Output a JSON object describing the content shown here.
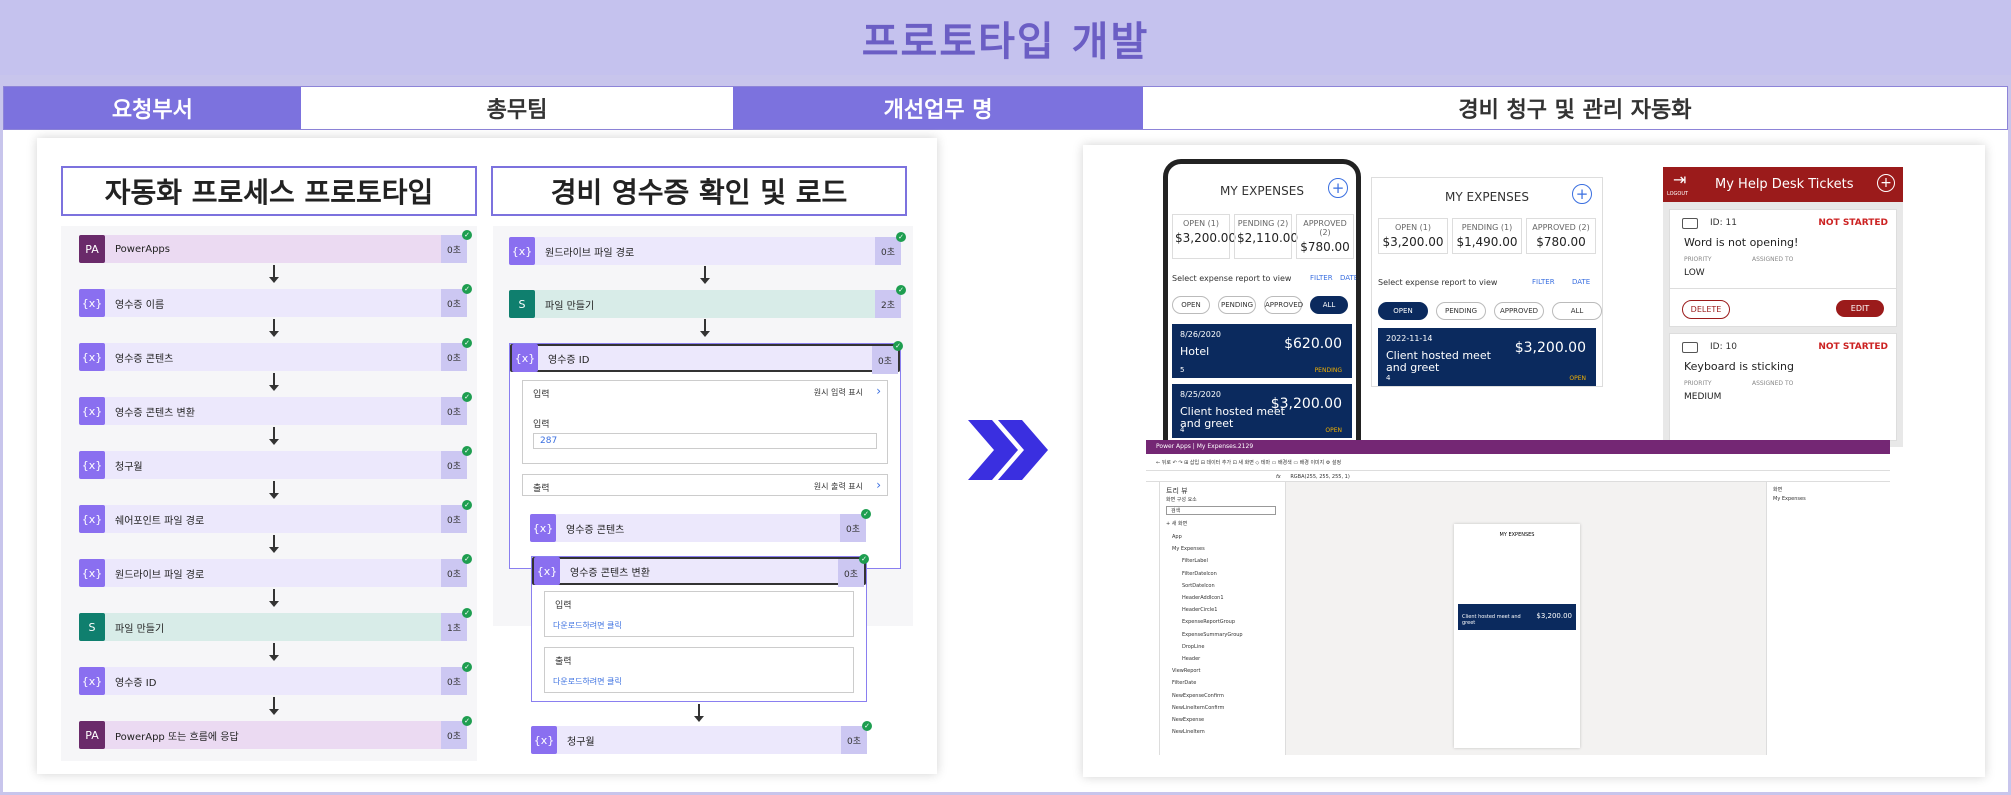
{
  "page_title": "프로토타입 개발",
  "info": {
    "dept_label": "요청부서",
    "dept_value": "총무팀",
    "task_label": "개선업무 명",
    "task_value": "경비 청구 및 관리 자동화"
  },
  "flow1": {
    "title": "자동화 프로세스 프로토타입",
    "steps": [
      {
        "label": "PowerApps",
        "dur": "0초"
      },
      {
        "label": "영수증 이름",
        "dur": "0초"
      },
      {
        "label": "영수증 콘텐츠",
        "dur": "0초"
      },
      {
        "label": "영수증 콘텐츠 변환",
        "dur": "0초"
      },
      {
        "label": "청구월",
        "dur": "0초"
      },
      {
        "label": "쉐어포인트 파일 경로",
        "dur": "0초"
      },
      {
        "label": "원드라이브 파일 경로",
        "dur": "0초"
      },
      {
        "label": "파일 만들기",
        "dur": "1초"
      },
      {
        "label": "영수증 ID",
        "dur": "0초"
      },
      {
        "label": "PowerApp 또는 흐름에 응답",
        "dur": "0초"
      }
    ]
  },
  "flow2": {
    "title": "경비 영수증 확인 및 로드",
    "steps": [
      {
        "label": "원드라이브 파일 경로",
        "dur": "0초"
      },
      {
        "label": "파일 만들기",
        "dur": "2초"
      },
      {
        "label": "영수증 ID",
        "dur": "0초"
      }
    ],
    "input_header": "입력",
    "input_link": "원시 입력 표시",
    "input_label": "입력",
    "input_value": "287",
    "output_header": "출력",
    "output_link": "원시 출력 표시",
    "inner_step1": {
      "label": "영수증 콘텐츠",
      "dur": "0초"
    },
    "inner_step2": {
      "label": "영수증 콘텐츠 변환",
      "dur": "0초"
    },
    "inner_input": "입력",
    "inner_input_link": "다운로드하려면 클릭",
    "inner_output": "출력",
    "inner_output_link": "다운로드하려면 클릭",
    "last_step": {
      "label": "청구월",
      "dur": "0초"
    }
  },
  "expenses_phone": {
    "title": "MY EXPENSES",
    "stats": [
      {
        "label": "OPEN (1)",
        "value": "$3,200.00"
      },
      {
        "label": "PENDING (2)",
        "value": "$2,110.00"
      },
      {
        "label": "APPROVED (2)",
        "value": "$780.00"
      }
    ],
    "select_text": "Select expense report to view",
    "filter": "FILTER",
    "date": "DATE",
    "pills": [
      "OPEN",
      "PENDING",
      "APPROVED",
      "ALL"
    ],
    "cards": [
      {
        "date": "8/26/2020",
        "name": "Hotel",
        "amount": "$620.00",
        "count": "5",
        "status": "PENDING"
      },
      {
        "date": "8/25/2020",
        "name": "Client hosted meet and greet",
        "amount": "$3,200.00",
        "count": "4",
        "status": "OPEN"
      }
    ]
  },
  "expenses_tablet": {
    "title": "MY EXPENSES",
    "stats": [
      {
        "label": "OPEN (1)",
        "value": "$3,200.00"
      },
      {
        "label": "PENDING (1)",
        "value": "$1,490.00"
      },
      {
        "label": "APPROVED (2)",
        "value": "$780.00"
      }
    ],
    "select_text": "Select expense report to view",
    "filter": "FILTER",
    "date": "DATE",
    "pills": [
      "OPEN",
      "PENDING",
      "APPROVED",
      "ALL"
    ],
    "card": {
      "date": "2022-11-14",
      "name": "Client hosted meet and greet",
      "amount": "$3,200.00",
      "count": "4",
      "status": "OPEN"
    }
  },
  "helpdesk": {
    "logout": "LOGOUT",
    "title": "My Help Desk Tickets",
    "tickets": [
      {
        "id": "ID: 11",
        "status": "NOT STARTED",
        "title": "Word is not opening!",
        "priority_label": "PRIORITY",
        "assigned_label": "ASSIGNED TO",
        "priority": "LOW",
        "delete": "DELETE",
        "edit": "EDIT"
      },
      {
        "id": "ID: 10",
        "status": "NOT STARTED",
        "title": "Keyboard is sticking",
        "priority_label": "PRIORITY",
        "assigned_label": "ASSIGNED TO",
        "priority": "MEDIUM"
      }
    ]
  },
  "studio": {
    "app_bar": "Power Apps  |  My Expenses.2129",
    "command_bar": "← 뒤로   ↶   ↷   ⊞ 삽입  ⊟ 데이터 추가  ⊡ 새 화면  ◇ 테마  ▭ 배경색  ▭ 배경 이미지  ⚙ 설정",
    "formula": "RGBA(255, 255, 255, 1)",
    "tree_title": "트리 뷰",
    "tree_tabs": "화면   구성 요소",
    "search": "검색",
    "new_screen": "+ 새 화면",
    "tree_items": [
      "App",
      "My Expenses",
      "FilterLabel",
      "FilterDateIcon",
      "SortDateIcon",
      "HeaderAddIcon1",
      "HeaderCircle1",
      "ExpenseReportGroup",
      "ExpenseSummaryGroup",
      "DropLine",
      "Header",
      "ViewReport",
      "FilterDate",
      "NewExpenseConfirm",
      "NewLineItemConfirm",
      "NewExpense",
      "NewLineItem"
    ],
    "props_title": "화면",
    "props_name": "My Expenses",
    "canvas_title": "MY EXPENSES",
    "canvas_amount": "$3,200.00",
    "canvas_name": "Client hosted meet and greet"
  }
}
